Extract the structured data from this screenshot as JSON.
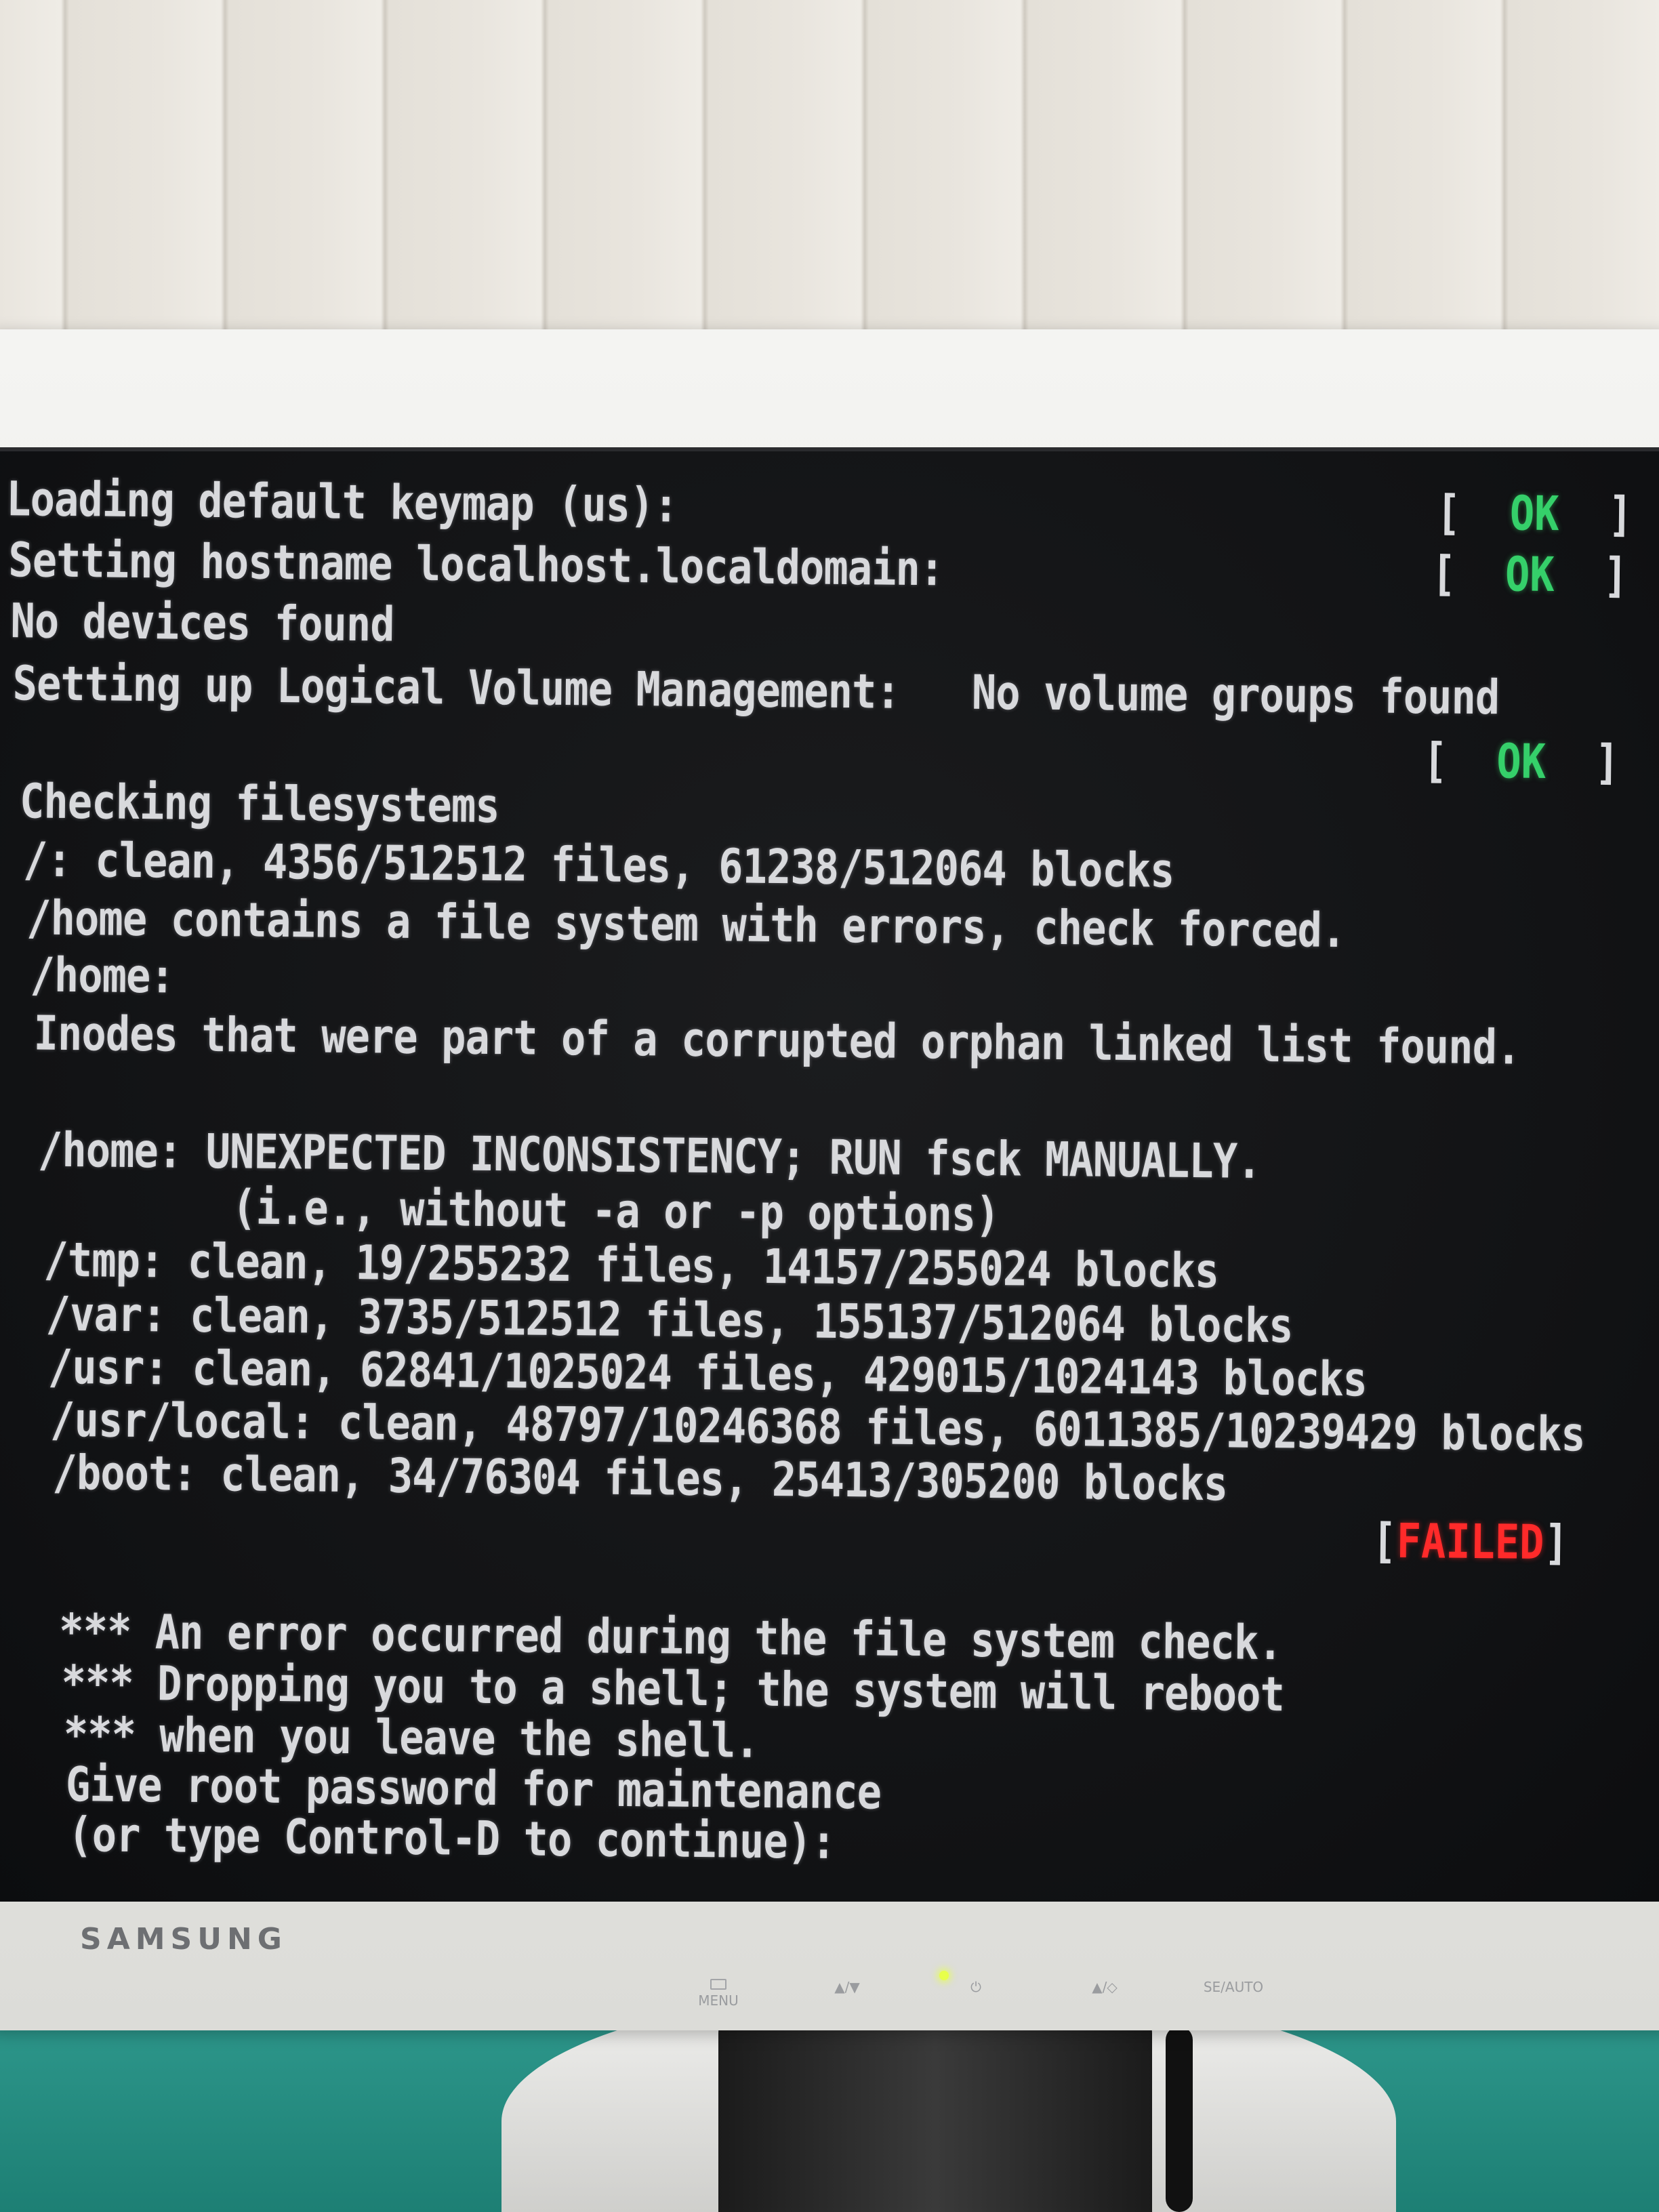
{
  "monitor": {
    "brand": "SAMSUNG",
    "controls": [
      {
        "icon": "menu-icon",
        "label": "MENU"
      },
      {
        "icon": "brightness-icon",
        "label": "▲/▼"
      },
      {
        "icon": "power-icon",
        "label": "⏻"
      },
      {
        "icon": "source-icon",
        "label": "▲/◇"
      },
      {
        "icon": "auto-icon",
        "label": "SE/AUTO"
      }
    ]
  },
  "console": {
    "lines": [
      "Loading default keymap (us):",
      "Setting hostname localhost.localdomain:",
      "No devices found",
      "Setting up Logical Volume Management:   No volume groups found",
      "Checking filesystems",
      "/: clean, 4356/512512 files, 61238/512064 blocks",
      "/home contains a file system with errors, check forced.",
      "/home:",
      "Inodes that were part of a corrupted orphan linked list found.",
      "/home: UNEXPECTED INCONSISTENCY; RUN fsck MANUALLY.",
      "        (i.e., without -a or -p options)",
      "/tmp: clean, 19/255232 files, 14157/255024 blocks",
      "/var: clean, 3735/512512 files, 155137/512064 blocks",
      "/usr: clean, 62841/1025024 files, 429015/1024143 blocks",
      "/usr/local: clean, 48797/10246368 files, 6011385/10239429 blocks",
      "/boot: clean, 34/76304 files, 25413/305200 blocks",
      "*** An error occurred during the file system check.",
      "*** Dropping you to a shell; the system will reboot",
      "*** when you leave the shell.",
      "Give root password for maintenance",
      "(or type Control-D to continue):"
    ],
    "status": {
      "open": "[",
      "close": "]",
      "ok": "OK",
      "failed": "FAILED"
    }
  },
  "colors": {
    "text": "#d8d9dc",
    "ok": "#35d06a",
    "failed": "#ff2a2a",
    "screen": "#111214"
  }
}
